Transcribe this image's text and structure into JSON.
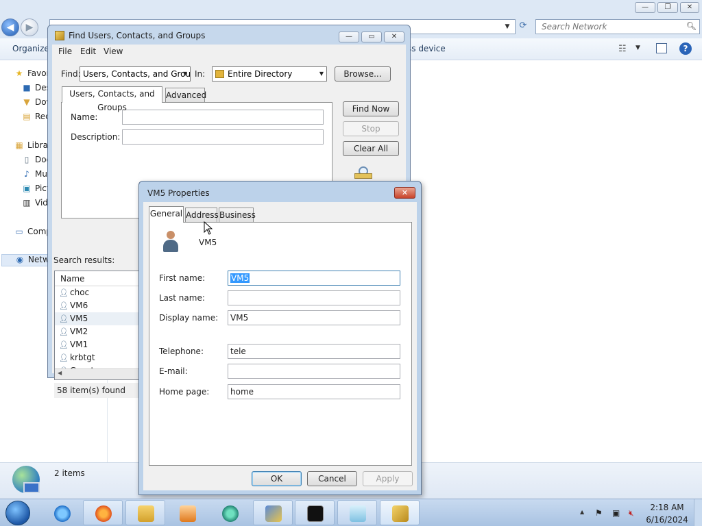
{
  "explorer": {
    "search": {
      "placeholder": "Search Network"
    },
    "toolbar": {
      "organize": "Organize",
      "right_partial": "ss device"
    },
    "nav": {
      "favorites": "Favor",
      "desktop": "Des",
      "downloads": "Dov",
      "recent": "Rec",
      "libraries": "Libra",
      "documents": "Doc",
      "music": "Mu",
      "pictures": "Pict",
      "videos": "Vid",
      "computer": "Comp",
      "network": "Netw"
    },
    "status": {
      "count": "2 items"
    }
  },
  "find_window": {
    "title": "Find Users, Contacts, and Groups",
    "menu": {
      "file": "File",
      "edit": "Edit",
      "view": "View"
    },
    "find_label": "Find:",
    "find_value": "Users, Contacts, and Groups",
    "in_label": "In:",
    "in_value": "Entire Directory",
    "browse": "Browse...",
    "tabs": {
      "main": "Users, Contacts, and Groups",
      "advanced": "Advanced"
    },
    "name_label": "Name:",
    "description_label": "Description:",
    "find_now": "Find Now",
    "stop": "Stop",
    "clear_all": "Clear All",
    "search_results_label": "Search results:",
    "results_header": "Name",
    "results": [
      "choc",
      "VM6",
      "VM5",
      "VM2",
      "VM1",
      "krbtgt",
      "Guest"
    ],
    "status": "58 item(s) found"
  },
  "props_window": {
    "title": "VM5 Properties",
    "tabs": {
      "general": "General",
      "address": "Address",
      "business": "Business"
    },
    "display": "VM5",
    "first_name_label": "First name:",
    "first_name_value": "VM5",
    "last_name_label": "Last name:",
    "last_name_value": "",
    "display_name_label": "Display name:",
    "display_name_value": "VM5",
    "telephone_label": "Telephone:",
    "telephone_value": "tele",
    "email_label": "E-mail:",
    "email_value": "",
    "homepage_label": "Home page:",
    "homepage_value": "home",
    "ok": "OK",
    "cancel": "Cancel",
    "apply": "Apply"
  },
  "taskbar": {
    "clock_time": "2:18 AM",
    "clock_date": "6/16/2024"
  }
}
